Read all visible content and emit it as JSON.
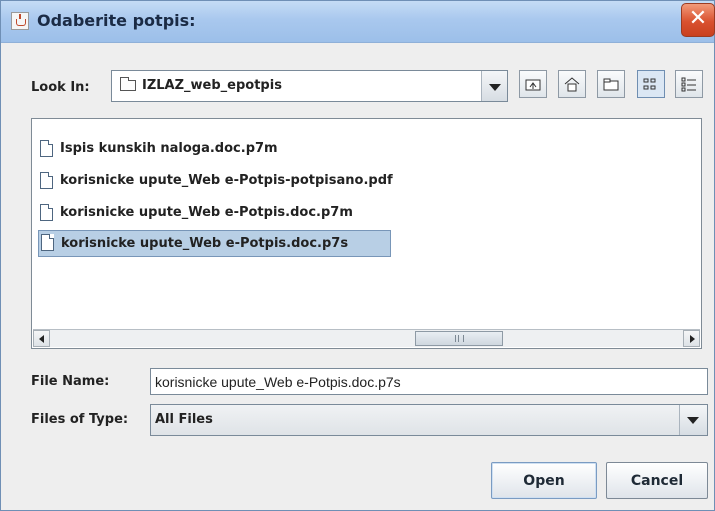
{
  "window": {
    "title": "Odaberite potpis:",
    "close_glyph": "✕"
  },
  "lookin": {
    "label": "Look In:",
    "value": "IZLAZ_web_epotpis"
  },
  "toolbar": {
    "buttons": [
      "up-folder-icon",
      "home-icon",
      "new-folder-icon",
      "list-view-icon",
      "details-view-icon"
    ]
  },
  "files": [
    {
      "name": "Ispis kunskih naloga.doc.p7m",
      "selected": false
    },
    {
      "name": "korisnicke upute_Web e-Potpis-potpisano.pdf",
      "selected": false
    },
    {
      "name": "korisnicke upute_Web e-Potpis.doc.p7m",
      "selected": false
    },
    {
      "name": "korisnicke upute_Web e-Potpis.doc.p7s",
      "selected": true
    }
  ],
  "filename": {
    "label": "File Name:",
    "value": "korisnicke upute_Web e-Potpis.doc.p7s"
  },
  "filetype": {
    "label": "Files of Type:",
    "value": "All Files"
  },
  "buttons": {
    "open": "Open",
    "cancel": "Cancel"
  },
  "colors": {
    "title_bar": "#a9c8ee",
    "selection": "#b8cfe5",
    "close_button": "#d9512f"
  }
}
